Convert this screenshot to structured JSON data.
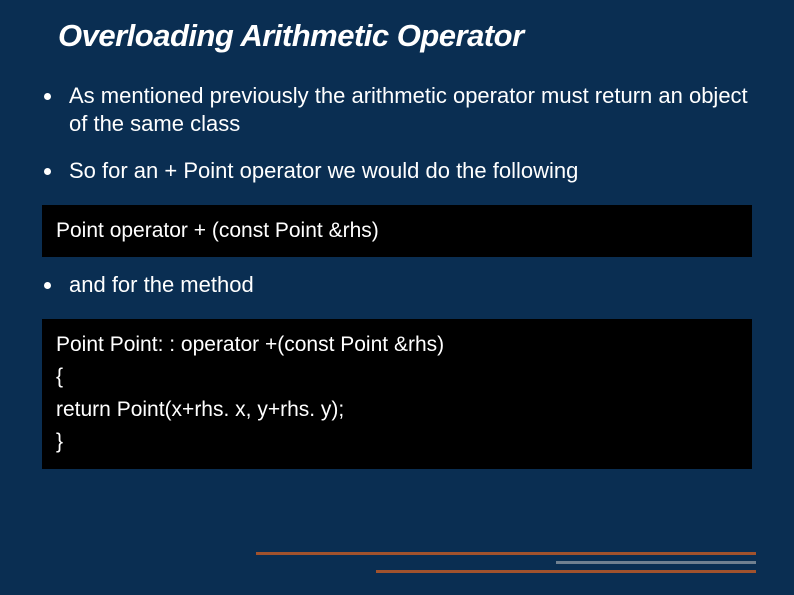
{
  "title": "Overloading Arithmetic Operator",
  "bullets": {
    "b1": "As mentioned previously the arithmetic operator must return an object of  the same class",
    "b2": "So for an + Point operator we would do the following",
    "b3": "and for the method"
  },
  "code1": {
    "line1": "Point operator + (const Point &rhs)"
  },
  "code2": {
    "line1": "Point Point: : operator +(const Point &rhs)",
    "line2": "{",
    "line3": "return Point(x+rhs. x, y+rhs. y);",
    "line4": "}"
  }
}
